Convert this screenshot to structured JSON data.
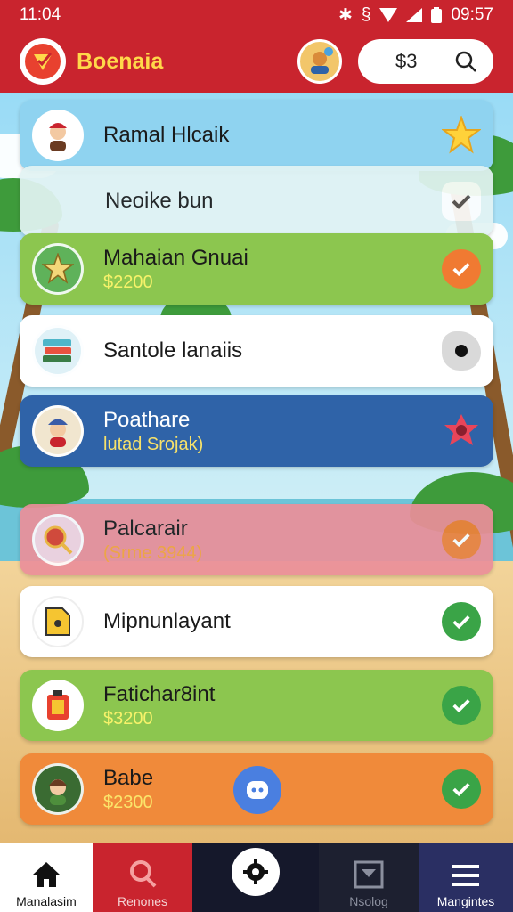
{
  "status_bar": {
    "time": "11:04",
    "clock": "09:57",
    "icons": [
      "bluetooth-icon",
      "vibrate-icon",
      "wifi-icon",
      "signal-icon",
      "battery-icon"
    ]
  },
  "app_bar": {
    "title": "Boenaia",
    "search_value": "$3",
    "accent": "#c9242e"
  },
  "list": {
    "items": [
      {
        "title": "Ramal Hlcaik",
        "subtitle": "",
        "icon": "person-icon",
        "color": "#8fd3f0",
        "status": "star"
      },
      {
        "title": "Neoike bun",
        "subtitle": "",
        "icon": "",
        "color": "#e3f4f4",
        "status": "check-grey"
      },
      {
        "title": "Mahaian Gnuai",
        "subtitle": "$2200",
        "icon": "star-icon",
        "color": "#8cc64f",
        "status": "check-orange"
      },
      {
        "title": "Santole lanaiis",
        "subtitle": "",
        "icon": "books-icon",
        "color": "#ffffff",
        "status": "blob"
      },
      {
        "title": "Poathare",
        "subtitle": "lutad Srojak)",
        "icon": "person-hat-icon",
        "color": "#2f63a8",
        "status": "flower"
      },
      {
        "title": "Palcarair",
        "subtitle": "(Srme 3944)",
        "icon": "magnifier-icon",
        "color": "#eb8f9a",
        "status": "check-orange"
      },
      {
        "title": "Mipnunlayant",
        "subtitle": "",
        "icon": "document-icon",
        "color": "#ffffff",
        "status": "check-green"
      },
      {
        "title": "Fatichar8int",
        "subtitle": "$3200",
        "icon": "fuel-can-icon",
        "color": "#8cc64f",
        "status": "check-green"
      },
      {
        "title": "Babe",
        "subtitle": "$2300",
        "icon": "person-icon",
        "color": "#f08a3a",
        "status": "check-green"
      }
    ]
  },
  "bottom_nav": {
    "items": [
      {
        "label": "Manalasim",
        "icon": "home-icon"
      },
      {
        "label": "Renones",
        "icon": "search-icon"
      },
      {
        "label": "",
        "icon": "gear-icon"
      },
      {
        "label": "Nsolog",
        "icon": "inbox-icon"
      },
      {
        "label": "Mangintes",
        "icon": "menu-icon"
      }
    ]
  }
}
